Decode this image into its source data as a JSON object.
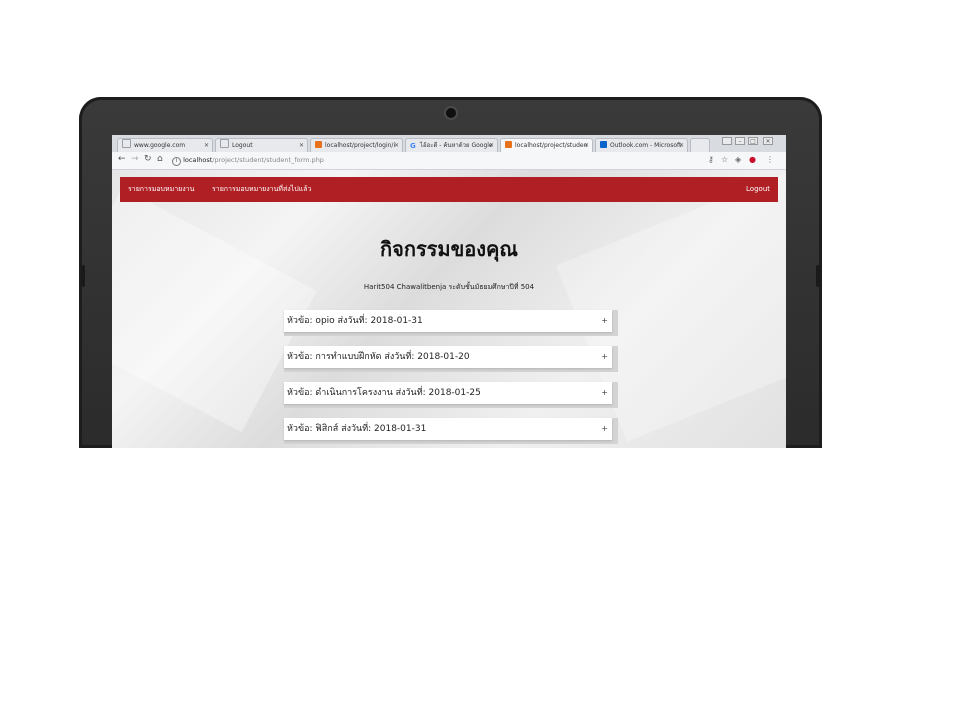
{
  "browser": {
    "tabs": [
      {
        "label": "www.google.com",
        "favicon": "page-icon",
        "color": "#9aa0a6"
      },
      {
        "label": "Logout",
        "favicon": "page-icon",
        "color": "#9aa0a6"
      },
      {
        "label": "localhost/project/login/i",
        "favicon": "app-icon",
        "color": "#e8721c"
      },
      {
        "label": "ไอ้อะดี - ค้นหาด้วย Google",
        "favicon": "google-icon",
        "color": "#4285f4"
      },
      {
        "label": "localhost/project/studen",
        "favicon": "app-icon",
        "color": "#e8721c"
      },
      {
        "label": "Outlook.com - Microsoft",
        "favicon": "outlook-icon",
        "color": "#0a64c9"
      }
    ],
    "url_host": "localhost",
    "url_path": "/project/student/student_form.php"
  },
  "navbar": {
    "link1": "รายการมอบหมายงาน",
    "link2": "รายการมอบหมายงานที่ส่งไปแล้ว",
    "logout": "Logout",
    "color": "#b01f24"
  },
  "main": {
    "title": "กิจกรรมของคุณ",
    "subtitle": "Harit504 Chawalitbenja ระดับชั้นมัธยมศึกษาปีที่ 504",
    "items": [
      {
        "label": "หัวข้อ: opio ส่งวันที่: 2018-01-31"
      },
      {
        "label": "หัวข้อ: การทำแบบฝึกหัด ส่งวันที่: 2018-01-20"
      },
      {
        "label": "หัวข้อ: ดำเนินการโครงงาน ส่งวันที่: 2018-01-25"
      },
      {
        "label": "หัวข้อ: ฟิสิกส์ ส่งวันที่: 2018-01-31"
      }
    ],
    "expand_symbol": "+"
  }
}
